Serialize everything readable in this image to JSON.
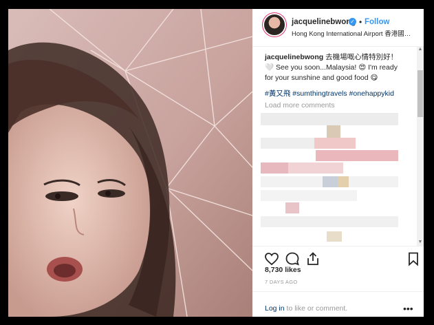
{
  "profile": {
    "username": "jacquelinebwong",
    "follow_label": "Follow",
    "location": "Hong Kong International Airport 香港國際機場"
  },
  "caption": {
    "username": "jacquelinebwong",
    "text": " 去機場嘅心情特別好！🤍 See you soon...Malaysia! 😍 I'm ready for your sunshine and good food 😋",
    "hashtags": "#黃又飛 #sumthingtravels #onehappykid"
  },
  "comments": {
    "load_more_label": "Load more comments"
  },
  "engagement": {
    "likes": "8,730 likes",
    "time": "7 DAYS AGO"
  },
  "footer": {
    "login_link": "Log in",
    "login_text": " to like or comment.",
    "more_label": "•••"
  },
  "icons": [
    "heart-icon",
    "comment-icon",
    "share-icon",
    "bookmark-icon",
    "verified-badge-icon"
  ],
  "colors": {
    "link_blue": "#3897f0",
    "hashtag_blue": "#003569",
    "muted": "#999999"
  }
}
